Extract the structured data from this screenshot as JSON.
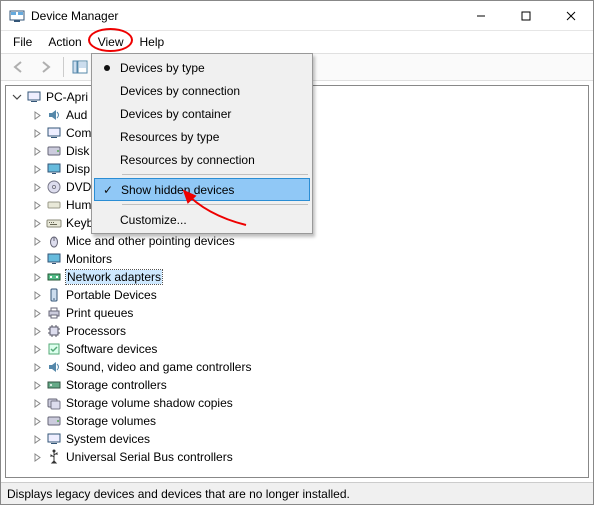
{
  "window": {
    "title": "Device Manager"
  },
  "menu": {
    "file": "File",
    "action": "Action",
    "view": "View",
    "help": "Help"
  },
  "dropdown": {
    "devices_by_type": "Devices by type",
    "devices_by_connection": "Devices by connection",
    "devices_by_container": "Devices by container",
    "resources_by_type": "Resources by type",
    "resources_by_connection": "Resources by connection",
    "show_hidden": "Show hidden devices",
    "customize": "Customize..."
  },
  "tree": {
    "root": "PC-Apri",
    "items": [
      "Aud",
      "Com",
      "Disk",
      "Disp",
      "DVD",
      "Hum",
      "Keyb",
      "Mice and other pointing devices",
      "Monitors",
      "Network adapters",
      "Portable Devices",
      "Print queues",
      "Processors",
      "Software devices",
      "Sound, video and game controllers",
      "Storage controllers",
      "Storage volume shadow copies",
      "Storage volumes",
      "System devices",
      "Universal Serial Bus controllers"
    ],
    "selected_index": 9
  },
  "status": "Displays legacy devices and devices that are no longer installed."
}
